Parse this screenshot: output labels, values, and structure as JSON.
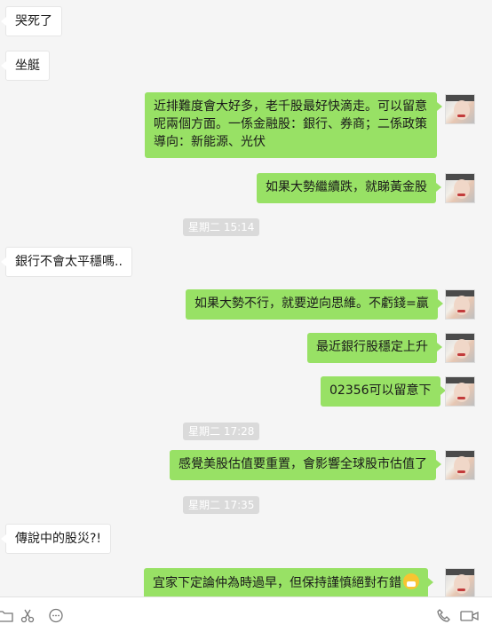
{
  "messages": [
    {
      "side": "left",
      "text": "哭死了"
    },
    {
      "side": "left",
      "text": "坐艇"
    },
    {
      "side": "right",
      "text": "近排難度會大好多，老千股最好快滴走。可以留意呢兩個方面。一係金融股：銀行、券商；二係政策導向：新能源、光伏"
    },
    {
      "side": "right",
      "text": "如果大勢繼續跌，就睇黃金股"
    },
    {
      "side": "time",
      "text": "星期二 15:14"
    },
    {
      "side": "left",
      "text": "銀行不會太平穩嗎.."
    },
    {
      "side": "right",
      "text": "如果大勢不行，就要逆向思維。不虧錢=赢"
    },
    {
      "side": "right",
      "text": "最近銀行股穩定上升"
    },
    {
      "side": "right",
      "text": "02356可以留意下"
    },
    {
      "side": "time",
      "text": "星期二 17:28"
    },
    {
      "side": "right",
      "text": "感覺美股估值要重置，會影響全球股市估值了"
    },
    {
      "side": "time",
      "text": "星期二 17:35"
    },
    {
      "side": "left",
      "text": "傳說中的股災?!"
    },
    {
      "side": "right",
      "text": "宜家下定論仲為時過早，但保持謹慎絕對冇錯",
      "emoji": "mask-face-emoji"
    }
  ],
  "toolbar": {
    "icons": [
      "folder-icon",
      "scissors-icon",
      "chat-bubble-icon",
      "phone-icon",
      "video-icon"
    ]
  },
  "colors": {
    "self_bubble": "#98e165",
    "other_bubble": "#ffffff",
    "background": "#f5f5f5",
    "timestamp_bg": "#dadada"
  }
}
